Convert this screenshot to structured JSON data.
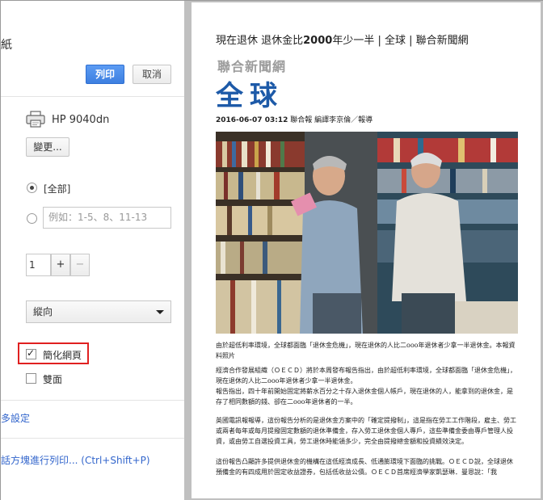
{
  "dialog": {
    "title_fragment": "紙",
    "print_label": "列印",
    "cancel_label": "取消"
  },
  "destination": {
    "printer_name": "HP 9040dn",
    "change_label": "變更..."
  },
  "pages": {
    "all_label": "[全部]",
    "range_placeholder": "例如：1-5、8、11-13"
  },
  "copies": {
    "value": "1",
    "plus": "+",
    "minus": "−"
  },
  "layout": {
    "selected": "縱向"
  },
  "options": {
    "simplify_label": "簡化網頁",
    "simplify_checked": true,
    "duplex_label": "雙面",
    "duplex_checked": false
  },
  "links": {
    "more_settings": "更多設定",
    "system_dialog": "話方塊進行列印... (Ctrl+Shift+P)"
  },
  "preview": {
    "title_a": "現在退休 退休金比",
    "title_b": "2000",
    "title_c": "年少一半 | 全球 | 聯合新聞網",
    "logo_sub": "聯合新聞網",
    "logo_main": "全球",
    "byline_date": "2016-06-07 03:12",
    "byline_rest": " 聯合報 編譯李京倫／報導",
    "caption": "由於超低利率環境，全球都面臨「退休金危機」，現在退休的人比二ooo年退休者少拿一半退休金。本報資料照片",
    "p1": "經濟合作發展組織（ＯＥＣＤ）將於本周發布報告指出，由於超低利率環境，全球都面臨「退休金危機」，現在退休的人比二ooo年退休者少拿一半退休金。",
    "p2": "報告指出，四十年前開始固定將薪水百分之十存入退休金個人帳戶，現在退休的人，能拿到的退休金，是存了相同數額的錢、卻在二ooo年退休者的一半。",
    "p3": "英國電訊報報導，這份報告分析的是退休金方案中的「確定提撥制」，這是指在勞工工作階段，雇主、勞工或兩者每年或每月提撥固定數額的退休準備金，存入勞工退休金個人專戶，這些準備金委由專戶管理人投資，或由勞工自選投資工具，勞工退休時能領多少，完全由提撥總金額和投資績效決定。",
    "p4": "這份報告凸顯許多提供退休金的機構在這低經濟成長、低通膨環境下面臨的挑戰。ＯＥＣＤ說，全球退休預備金的有四成用於固定收益證券，包括低收益公債。ＯＥＣＤ首席經濟學家凱瑟琳．曼恩說：「我"
  },
  "colors": {
    "print_button": "#3d7fe0",
    "highlight_border": "#e02020",
    "logo_blue": "#1d5aa8",
    "link_blue": "#3366cc"
  }
}
